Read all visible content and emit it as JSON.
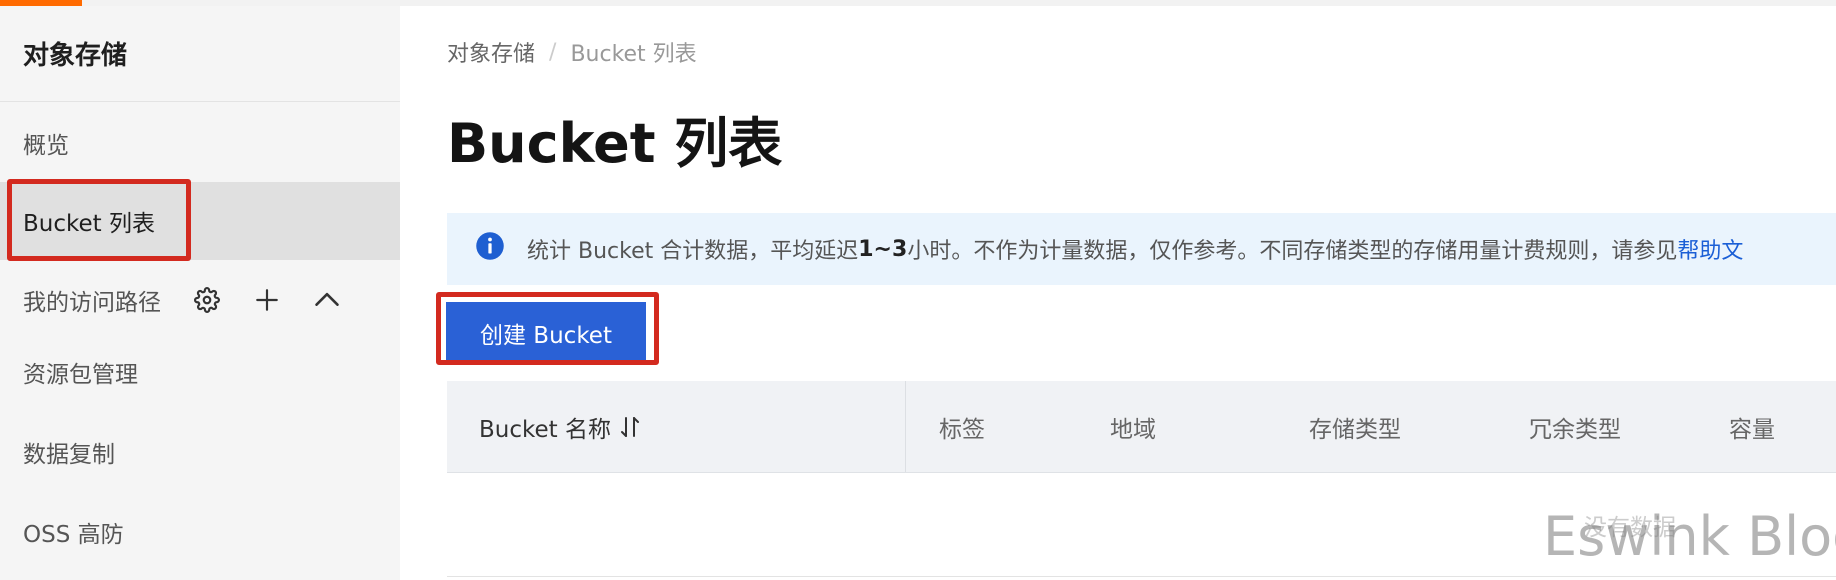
{
  "colors": {
    "accent": "#ff6a00",
    "primary_button": "#2a61d6",
    "highlight_border": "#d32a1f",
    "notice_bg": "#eaf4fd",
    "link": "#1b5fd6"
  },
  "sidebar": {
    "title": "对象存储",
    "items": [
      {
        "label": "概览"
      },
      {
        "label": "Bucket 列表",
        "active": true
      }
    ],
    "access_path": {
      "label": "我的访问路径",
      "icons": [
        "gear-icon",
        "plus-icon",
        "chevron-up-icon"
      ]
    },
    "items_after": [
      {
        "label": "资源包管理"
      },
      {
        "label": "数据复制"
      },
      {
        "label": "OSS 高防"
      }
    ]
  },
  "breadcrumb": {
    "root": "对象存储",
    "separator": "/",
    "current": "Bucket 列表"
  },
  "page": {
    "title": "Bucket 列表"
  },
  "notice": {
    "icon": "info-icon",
    "text_1": "统计 Bucket 合计数据，平均延迟 ",
    "text_bold": "1~3",
    "text_2": " 小时。不作为计量数据，仅作参考。不同存储类型的存储用量计费规则，请参见",
    "link": "帮助文"
  },
  "toolbar": {
    "create_label": "创建 Bucket"
  },
  "table": {
    "columns": [
      "Bucket 名称",
      "标签",
      "地域",
      "存储类型",
      "冗余类型",
      "容量"
    ],
    "empty_text": "没有数据"
  },
  "watermark": "Eswink Blog"
}
